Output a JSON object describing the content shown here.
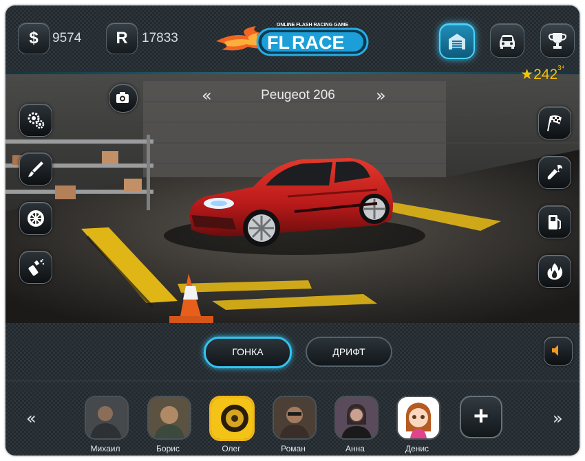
{
  "currencies": {
    "dollar_icon": "$",
    "dollar_value": "9574",
    "rep_icon": "R",
    "rep_value": "17833"
  },
  "logo": {
    "tagline": "ONLINE FLASH RACING GAME",
    "brand_left": "FL",
    "brand_right": "RACE"
  },
  "top_nav": {
    "items": [
      {
        "icon": "garage-icon",
        "active": true
      },
      {
        "icon": "car-icon",
        "active": false
      },
      {
        "icon": "trophy-icon",
        "active": false
      }
    ]
  },
  "rating": {
    "value": "242",
    "sup": "3⁴"
  },
  "car": {
    "name": "Peugeot 206",
    "color": "#c8201c"
  },
  "prev_arrow": "«",
  "next_arrow": "»",
  "left_tools": [
    "camera-icon",
    "gears-icon",
    "paintbrush-icon",
    "wheel-icon",
    "spray-icon"
  ],
  "right_tools": [
    "race-flag-icon",
    "wrench-icon",
    "fuel-icon",
    "nitro-flame-icon"
  ],
  "modes": {
    "race": "ГОНКА",
    "drift": "ДРИФТ",
    "active": "race"
  },
  "sound_icon": "speaker-icon",
  "friends": {
    "prev": "«",
    "next": "»",
    "add_label": "+",
    "list": [
      {
        "name": "Михаил"
      },
      {
        "name": "Борис"
      },
      {
        "name": "Олег",
        "highlight": true
      },
      {
        "name": "Роман"
      },
      {
        "name": "Анна"
      },
      {
        "name": "Денис"
      }
    ]
  },
  "colors": {
    "accent": "#36c3f5",
    "gold": "#f3b518",
    "logo_orange": "#f26522",
    "logo_blue": "#1c9fd8"
  }
}
